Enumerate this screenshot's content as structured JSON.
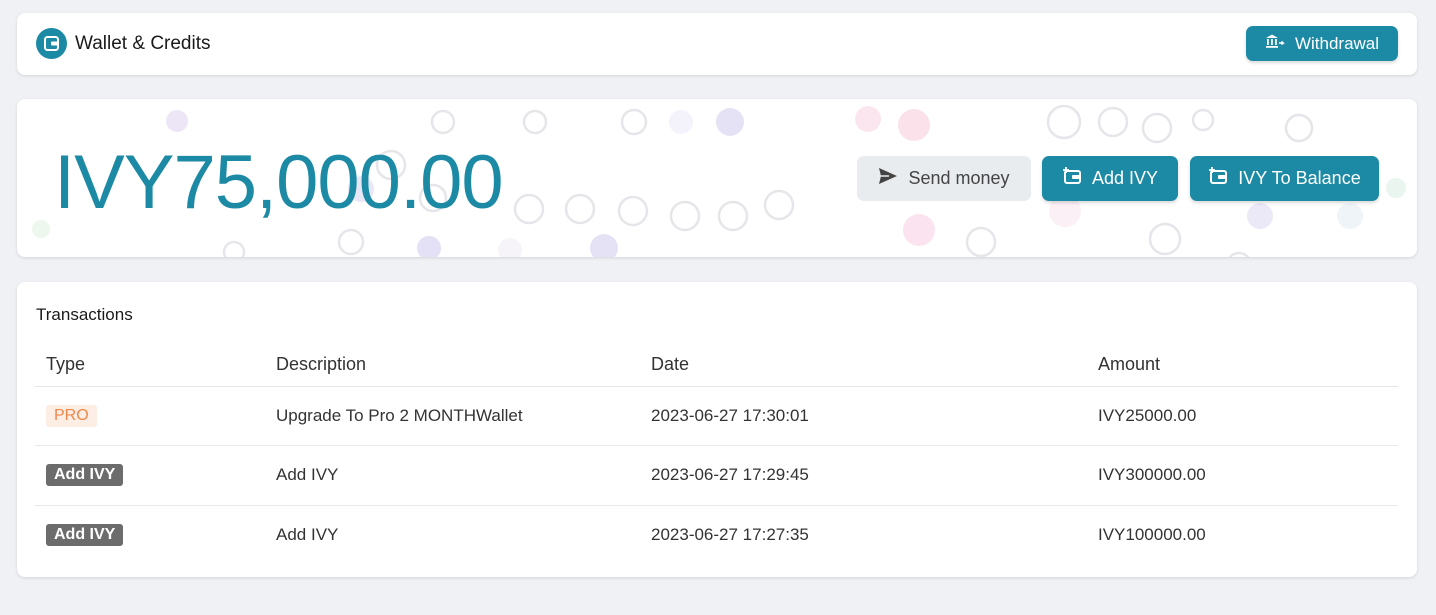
{
  "header": {
    "title": "Wallet & Credits",
    "withdraw_label": "Withdrawal",
    "logo_icon": "wallet-icon",
    "accent": "#1d8aa5"
  },
  "balance": {
    "amount": "IVY75,000.00",
    "send_label": "Send money",
    "add_label": "Add IVY",
    "to_balance_label": "IVY To Balance"
  },
  "transactions": {
    "title": "Transactions",
    "columns": [
      "Type",
      "Description",
      "Date",
      "Amount"
    ],
    "rows": [
      {
        "type": "PRO",
        "type_style": "pro",
        "description": "Upgrade To Pro 2 MONTHWallet",
        "date": "2023-06-27 17:30:01",
        "amount": "IVY25000.00"
      },
      {
        "type": "Add IVY",
        "type_style": "add",
        "description": "Add IVY",
        "date": "2023-06-27 17:29:45",
        "amount": "IVY300000.00"
      },
      {
        "type": "Add IVY",
        "type_style": "add",
        "description": "Add IVY",
        "date": "2023-06-27 17:27:35",
        "amount": "IVY100000.00"
      }
    ]
  }
}
